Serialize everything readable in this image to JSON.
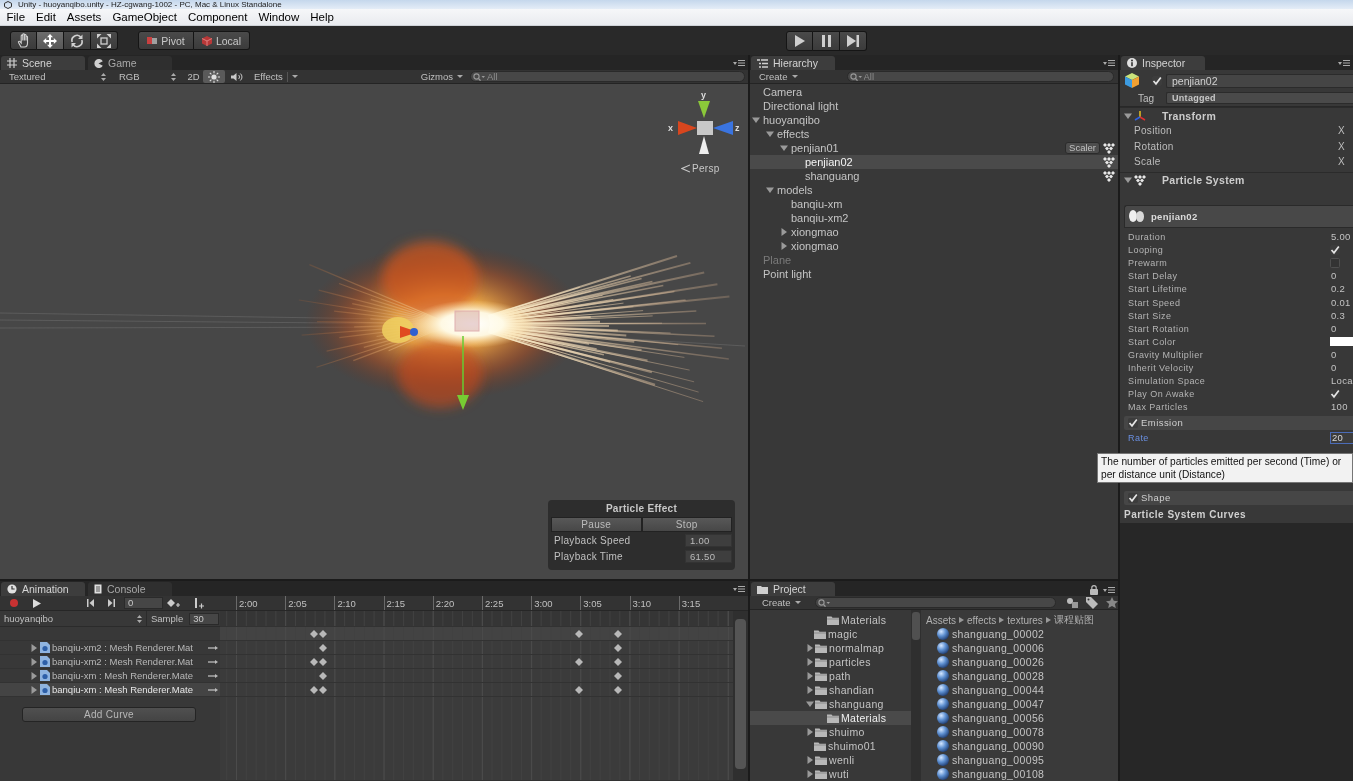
{
  "window": {
    "title": "Unity - huoyanqibo.unity - HZ-cgwang-1002 - PC, Mac & Linux Standalone"
  },
  "menu": [
    "File",
    "Edit",
    "Assets",
    "GameObject",
    "Component",
    "Window",
    "Help"
  ],
  "toolbar": {
    "tools": [
      {
        "kind": "hand",
        "selected": false
      },
      {
        "kind": "move",
        "selected": true
      },
      {
        "kind": "rotate",
        "selected": false
      },
      {
        "kind": "scale",
        "selected": false
      }
    ],
    "handles": [
      {
        "kind": "pivot",
        "label": "Pivot"
      },
      {
        "kind": "space",
        "label": "Local"
      }
    ],
    "playback": [
      {
        "kind": "play"
      },
      {
        "kind": "pause"
      },
      {
        "kind": "step"
      }
    ]
  },
  "scene": {
    "tabs": [
      {
        "kind": "scene",
        "label": "Scene",
        "selected": true
      },
      {
        "kind": "game",
        "label": "Game",
        "selected": false
      }
    ],
    "toolbar": {
      "render_mode": "Textured",
      "color_mode": "RGB",
      "toggles": [
        {
          "kind": "dimension",
          "label": "2D",
          "on": false
        },
        {
          "kind": "lighting",
          "on": true
        },
        {
          "kind": "audio",
          "on": false
        }
      ],
      "effects": "Effects",
      "gizmos": "Gizmos",
      "search": {
        "placeholder": "All"
      }
    },
    "gizmo": {
      "axes": [
        {
          "kind": "y",
          "label": "y"
        },
        {
          "kind": "x",
          "label": "x"
        },
        {
          "kind": "z",
          "label": "z"
        }
      ],
      "projection": "Persp"
    },
    "particle_effect": {
      "title": "Particle Effect",
      "buttons": [
        "Pause",
        "Stop"
      ],
      "fields": [
        {
          "label": "Playback Speed",
          "value": "1.00"
        },
        {
          "label": "Playback Time",
          "value": "61.50"
        }
      ]
    }
  },
  "hierarchy": {
    "tabs": [
      {
        "kind": "hierarchy",
        "label": "Hierarchy",
        "selected": true
      }
    ],
    "create": "Create",
    "search": {
      "placeholder": "All"
    },
    "items": [
      {
        "name": "Camera",
        "particle_system": false,
        "active": true,
        "selected": false,
        "expandable": false
      },
      {
        "name": "Directional light",
        "particle_system": false,
        "active": true,
        "selected": false,
        "expandable": false
      },
      {
        "name": "huoyanqibo",
        "particle_system": false,
        "active": true,
        "selected": false,
        "expandable": true,
        "expanded": true,
        "children": [
          {
            "name": "effects",
            "particle_system": false,
            "active": true,
            "selected": false,
            "expandable": true,
            "expanded": true,
            "children": [
              {
                "name": "penjian01",
                "particle_system": true,
                "active": true,
                "selected": false,
                "expandable": true,
                "expanded": true,
                "button": "Scaler",
                "children": [
                  {
                    "name": "penjian02",
                    "particle_system": true,
                    "active": true,
                    "selected": true,
                    "expandable": false
                  },
                  {
                    "name": "shanguang",
                    "particle_system": true,
                    "active": true,
                    "selected": false,
                    "expandable": false
                  }
                ]
              }
            ]
          },
          {
            "name": "models",
            "particle_system": false,
            "active": true,
            "selected": false,
            "expandable": true,
            "expanded": true,
            "children": [
              {
                "name": "banqiu-xm",
                "particle_system": false,
                "active": true,
                "selected": false,
                "expandable": false
              },
              {
                "name": "banqiu-xm2",
                "particle_system": false,
                "active": true,
                "selected": false,
                "expandable": false
              },
              {
                "name": "xiongmao",
                "particle_system": false,
                "active": true,
                "selected": false,
                "expandable": true,
                "expanded": false
              },
              {
                "name": "xiongmao",
                "particle_system": false,
                "active": true,
                "selected": false,
                "expandable": true,
                "expanded": false
              }
            ]
          }
        ]
      },
      {
        "name": "Plane",
        "particle_system": false,
        "active": false,
        "selected": false,
        "expandable": false
      },
      {
        "name": "Point light",
        "particle_system": false,
        "active": true,
        "selected": false,
        "expandable": false
      }
    ]
  },
  "inspector": {
    "tabs": [
      {
        "kind": "inspector",
        "label": "Inspector",
        "selected": true
      }
    ],
    "object": {
      "active": true,
      "name": "penjian02",
      "tag_label": "Tag",
      "tag": "Untagged"
    },
    "components": [
      {
        "kind": "transform",
        "title": "Transform",
        "expanded": true,
        "rows": [
          {
            "label": "Position",
            "axis": "X"
          },
          {
            "label": "Rotation",
            "axis": "X"
          },
          {
            "label": "Scale",
            "axis": "X"
          }
        ]
      },
      {
        "kind": "particle_system",
        "title": "Particle System",
        "expanded": true,
        "main": {
          "title": "penjian02",
          "properties": [
            {
              "label": "Duration",
              "kind": "value",
              "value": "5.00"
            },
            {
              "label": "Looping",
              "kind": "checkbox",
              "checked": true
            },
            {
              "label": "Prewarm",
              "kind": "checkbox",
              "checked": false
            },
            {
              "label": "Start Delay",
              "kind": "value",
              "value": "0"
            },
            {
              "label": "Start Lifetime",
              "kind": "value",
              "value": "0.2"
            },
            {
              "label": "Start Speed",
              "kind": "value",
              "value": "0.01"
            },
            {
              "label": "Start Size",
              "kind": "value",
              "value": "0.3"
            },
            {
              "label": "Start Rotation",
              "kind": "value",
              "value": "0"
            },
            {
              "label": "Start Color",
              "kind": "color",
              "color": "#ffffff"
            },
            {
              "label": "Gravity Multiplier",
              "kind": "value",
              "value": "0"
            },
            {
              "label": "Inherit Velocity",
              "kind": "value",
              "value": "0"
            },
            {
              "label": "Simulation Space",
              "kind": "dropdown",
              "value": "Loca"
            },
            {
              "label": "Play On Awake",
              "kind": "checkbox",
              "checked": true
            },
            {
              "label": "Max Particles",
              "kind": "value",
              "value": "100"
            }
          ]
        },
        "modules": [
          {
            "title": "Emission",
            "enabled": true,
            "properties": [
              {
                "label": "Rate",
                "kind": "value",
                "value": "20",
                "hovered": true
              }
            ]
          },
          {
            "title": "Shape",
            "enabled": true
          }
        ],
        "curves_title": "Particle System Curves"
      }
    ],
    "tooltip": "The number of particles emitted per second (Time) or per distance unit (Distance)"
  },
  "animation": {
    "tabs": [
      {
        "kind": "animation",
        "label": "Animation",
        "selected": true
      },
      {
        "kind": "console",
        "label": "Console",
        "selected": false
      }
    ],
    "controls": [
      {
        "kind": "record"
      },
      {
        "kind": "play"
      },
      {
        "kind": "prev_key"
      },
      {
        "kind": "next_key"
      }
    ],
    "frame": "0",
    "key_tools": [
      {
        "kind": "add_key"
      },
      {
        "kind": "add_event"
      }
    ],
    "clip": "huoyanqibo",
    "sample_label": "Sample",
    "sample": "30",
    "ruler": [
      "2:00",
      "2:05",
      "2:10",
      "2:15",
      "2:20",
      "2:25",
      "3:00",
      "3:05",
      "3:10",
      "3:15"
    ],
    "summary_keys": [
      {
        "level": 0.183
      },
      {
        "level": 0.201
      },
      {
        "level": 0.7
      },
      {
        "level": 0.776
      }
    ],
    "curves": [
      {
        "name": "banqiu-xm2 : Mesh Renderer.Mat",
        "expanded": false,
        "selected": false,
        "keys": [
          {
            "level": 0.201
          },
          {
            "level": 0.776
          }
        ]
      },
      {
        "name": "banqiu-xm2 : Mesh Renderer.Mat",
        "expanded": false,
        "selected": false,
        "keys": [
          {
            "level": 0.183
          },
          {
            "level": 0.201
          },
          {
            "level": 0.7
          },
          {
            "level": 0.776
          }
        ]
      },
      {
        "name": "banqiu-xm : Mesh Renderer.Mate",
        "expanded": false,
        "selected": false,
        "keys": [
          {
            "level": 0.201
          },
          {
            "level": 0.776
          }
        ]
      },
      {
        "name": "banqiu-xm : Mesh Renderer.Mate",
        "expanded": false,
        "selected": true,
        "keys": [
          {
            "level": 0.183
          },
          {
            "level": 0.201
          },
          {
            "level": 0.7
          },
          {
            "level": 0.776
          }
        ]
      }
    ],
    "add_curve": "Add Curve"
  },
  "project": {
    "tabs": [
      {
        "kind": "project",
        "label": "Project",
        "selected": true
      }
    ],
    "create": "Create",
    "folders": {
      "continued": [
        {
          "name": "Materials",
          "expandable": false,
          "selected": false
        }
      ],
      "items": [
        {
          "name": "magic",
          "expandable": false,
          "selected": false
        },
        {
          "name": "normalmap",
          "expandable": true,
          "expanded": false,
          "selected": false
        },
        {
          "name": "particles",
          "expandable": true,
          "expanded": false,
          "selected": false
        },
        {
          "name": "path",
          "expandable": true,
          "expanded": false,
          "selected": false
        },
        {
          "name": "shandian",
          "expandable": true,
          "expanded": false,
          "selected": false
        },
        {
          "name": "shanguang",
          "expandable": true,
          "expanded": true,
          "selected": false,
          "children": [
            {
              "name": "Materials",
              "expandable": false,
              "selected": true
            }
          ]
        },
        {
          "name": "shuimo",
          "expandable": true,
          "expanded": false,
          "selected": false
        },
        {
          "name": "shuimo01",
          "expandable": false,
          "selected": false
        },
        {
          "name": "wenli",
          "expandable": true,
          "expanded": false,
          "selected": false
        },
        {
          "name": "wuti",
          "expandable": true,
          "expanded": false,
          "selected": false
        }
      ]
    },
    "breadcrumb": [
      "Assets",
      "effects",
      "textures",
      "课程贴图"
    ],
    "assets": [
      "shanguang_00002",
      "shanguang_00006",
      "shanguang_00026",
      "shanguang_00028",
      "shanguang_00044",
      "shanguang_00047",
      "shanguang_00056",
      "shanguang_00078",
      "shanguang_00090",
      "shanguang_00095",
      "shanguang_00108"
    ]
  }
}
